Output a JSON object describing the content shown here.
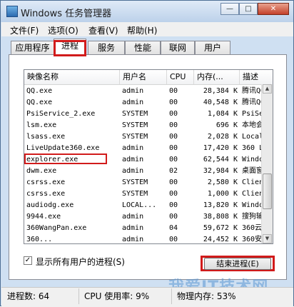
{
  "window": {
    "title": "Windows 任务管理器"
  },
  "window_buttons": {
    "minimize": "—",
    "maximize": "□",
    "close": "✕"
  },
  "menu": [
    "文件(F)",
    "选项(O)",
    "查看(V)",
    "帮助(H)"
  ],
  "tabs": [
    "应用程序",
    "进程",
    "服务",
    "性能",
    "联网",
    "用户"
  ],
  "active_tab": "进程",
  "columns": [
    "映像名称",
    "用户名",
    "CPU",
    "内存(...",
    "描述"
  ],
  "processes": [
    {
      "name": "QQ.exe",
      "user": "admin",
      "cpu": "00",
      "mem": "28,384 K",
      "desc": "腾讯QQ"
    },
    {
      "name": "QQ.exe",
      "user": "admin",
      "cpu": "00",
      "mem": "40,548 K",
      "desc": "腾讯QQ"
    },
    {
      "name": "PsiService_2.exe",
      "user": "SYSTEM",
      "cpu": "00",
      "mem": "1,084 K",
      "desc": "PsiSe"
    },
    {
      "name": "lsm.exe",
      "user": "SYSTEM",
      "cpu": "00",
      "mem": "696 K",
      "desc": "本地会"
    },
    {
      "name": "lsass.exe",
      "user": "SYSTEM",
      "cpu": "00",
      "mem": "2,028 K",
      "desc": "Local"
    },
    {
      "name": "LiveUpdate360.exe",
      "user": "admin",
      "cpu": "00",
      "mem": "17,420 K",
      "desc": "360 L"
    },
    {
      "name": "explorer.exe",
      "user": "admin",
      "cpu": "00",
      "mem": "62,544 K",
      "desc": "Windo"
    },
    {
      "name": "dwm.exe",
      "user": "admin",
      "cpu": "02",
      "mem": "32,984 K",
      "desc": "桌面窗"
    },
    {
      "name": "csrss.exe",
      "user": "SYSTEM",
      "cpu": "00",
      "mem": "2,580 K",
      "desc": "Clien"
    },
    {
      "name": "csrss.exe",
      "user": "SYSTEM",
      "cpu": "00",
      "mem": "1,000 K",
      "desc": "Clien"
    },
    {
      "name": "audiodg.exe",
      "user": "LOCAL...",
      "cpu": "00",
      "mem": "13,820 K",
      "desc": "Windo"
    },
    {
      "name": "9944.exe",
      "user": "admin",
      "cpu": "00",
      "mem": "38,808 K",
      "desc": "搜狗输"
    },
    {
      "name": "360WangPan.exe",
      "user": "admin",
      "cpu": "04",
      "mem": "59,672 K",
      "desc": "360云"
    },
    {
      "name": "360...",
      "user": "admin",
      "cpu": "00",
      "mem": "24,452 K",
      "desc": "360安"
    }
  ],
  "show_all_users": {
    "label": "显示所有用户的进程(S)",
    "checked": true,
    "mark": "✓"
  },
  "end_process_button": "结束进程(E)",
  "status": {
    "processes": "进程数: 64",
    "cpu": "CPU 使用率: 9%",
    "memory": "物理内存: 53%"
  },
  "watermark": "我爱IT技术网",
  "colors": {
    "highlight_red": "#d11b1b",
    "title_bar": "#cfe0f2"
  }
}
